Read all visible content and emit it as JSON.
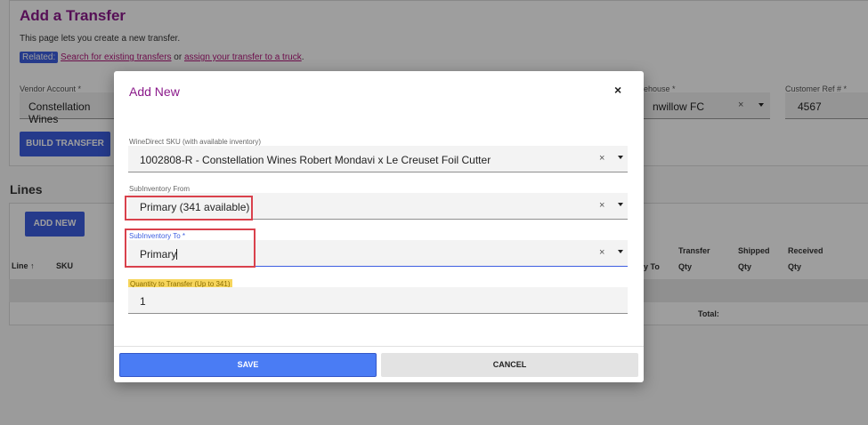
{
  "page": {
    "title": "Add a Transfer",
    "intro": "This page lets you create a new transfer.",
    "related_tag": "Related:",
    "related_link1": "Search for existing transfers",
    "related_or": " or ",
    "related_link2": "assign your transfer to a truck",
    "related_end": "."
  },
  "form": {
    "vendor_label": "Vendor Account *",
    "vendor_value": "Constellation Wines",
    "warehouse_label": "ehouse *",
    "warehouse_value": "nwillow FC",
    "customer_ref_label": "Customer Ref # *",
    "customer_ref_value": "4567",
    "build_button": "BUILD TRANSFER",
    "clear_icon": "×"
  },
  "lines": {
    "heading": "Lines",
    "add_new_button": "ADD NEW",
    "col_line": "Line",
    "col_sort": "↑",
    "col_sku": "SKU",
    "col_to": "y To",
    "col_transfer1": "Transfer",
    "col_transfer2": "Qty",
    "col_shipped1": "Shipped",
    "col_shipped2": "Qty",
    "col_received1": "Received",
    "col_received2": "Qty",
    "total_label": "Total:"
  },
  "modal": {
    "title": "Add New",
    "close_icon": "×",
    "clear_icon": "×",
    "sku_label": "WineDirect SKU (with available inventory)",
    "sku_value": "1002808-R - Constellation Wines Robert Mondavi x Le Creuset Foil Cutter",
    "from_label": "SubInventory From",
    "from_value": "Primary (341 available)",
    "to_label": "SubInventory To *",
    "to_value": "Primary",
    "qty_label": "Quantity to Transfer (Up to 341)",
    "qty_value": "1",
    "save_button": "SAVE",
    "cancel_button": "CANCEL"
  },
  "colors": {
    "accent": "#3d5ee0",
    "title": "#8b1a8b",
    "highlight_box": "#d9414c",
    "label_highlight": "#f6d55c"
  }
}
